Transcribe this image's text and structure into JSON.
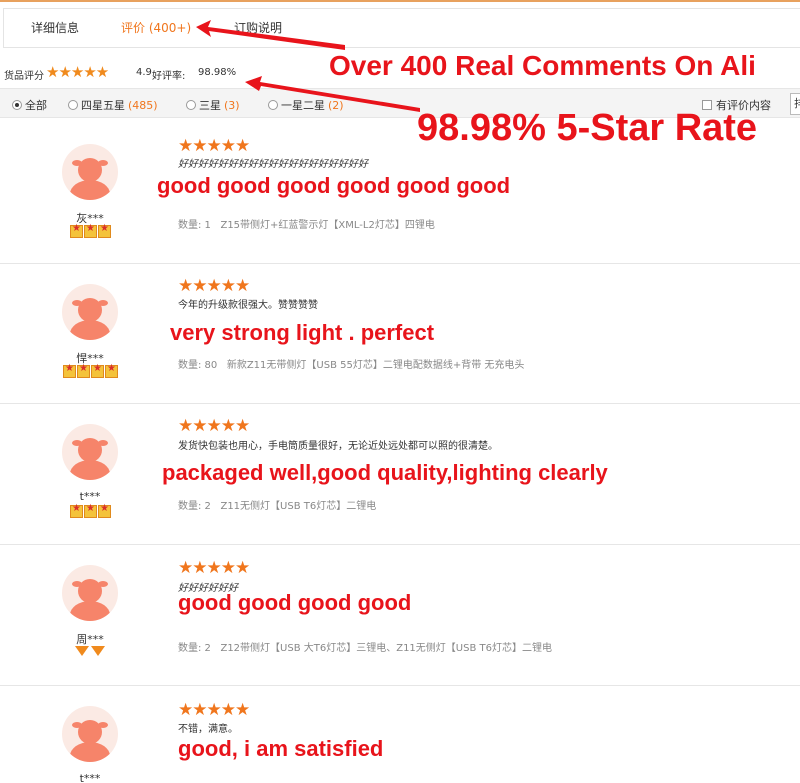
{
  "tabs": [
    {
      "label": "详细信息"
    },
    {
      "label": "评价 (400+)"
    },
    {
      "label": "订购说明"
    }
  ],
  "summary": {
    "label": "货品评分",
    "score": "4.9",
    "good_label": "好评率:",
    "good_rate": "98.98%",
    "stars": "★★★★★"
  },
  "filter": {
    "options": [
      {
        "label": "全部",
        "count": ""
      },
      {
        "label": "四星五星",
        "count": "(485)"
      },
      {
        "label": "三星",
        "count": "(3)"
      },
      {
        "label": "一星二星",
        "count": "(2)"
      }
    ],
    "has_content_label": "有评价内容",
    "sort_label": "排"
  },
  "promo": {
    "line1": "Over 400 Real Comments On Ali",
    "line2": "98.98% 5-Star Rate"
  },
  "reviews": [
    {
      "stars": "★★★★★",
      "text": "好好好好好好好好好好好好好好好好好好好",
      "translation": "good good good good good good",
      "username": "灰***",
      "qty": "数量: 1",
      "spec": "Z15带侧灯+红蓝警示灯【XML-L2灯芯】四锂电"
    },
    {
      "stars": "★★★★★",
      "text": "今年的升级款很强大。赞赞赞赞",
      "translation": "very strong light . perfect",
      "username": "悍***",
      "qty": "数量: 80",
      "spec": "新款Z11无带侧灯【USB 55灯芯】二锂电配数据线+背带 无充电头"
    },
    {
      "stars": "★★★★★",
      "text": "发货快包装也用心，手电筒质量很好，无论近处远处都可以照的很清楚。",
      "translation": "packaged well,good quality,lighting clearly",
      "username": "t***",
      "qty": "数量: 2",
      "spec": "Z11无侧灯【USB T6灯芯】二锂电"
    },
    {
      "stars": "★★★★★",
      "text": "好好好好好好",
      "translation": "good good good good",
      "username": "周***",
      "qty": "数量: 2",
      "spec": "Z12带侧灯【USB 大T6灯芯】三锂电、Z11无侧灯【USB T6灯芯】二锂电"
    },
    {
      "stars": "★★★★★",
      "text": "不错，满意。",
      "translation": "good, i am satisfied",
      "username": "t***",
      "qty": "",
      "spec": ""
    }
  ],
  "colors": {
    "accent": "#f0761d",
    "promo_red": "#e8141b"
  }
}
